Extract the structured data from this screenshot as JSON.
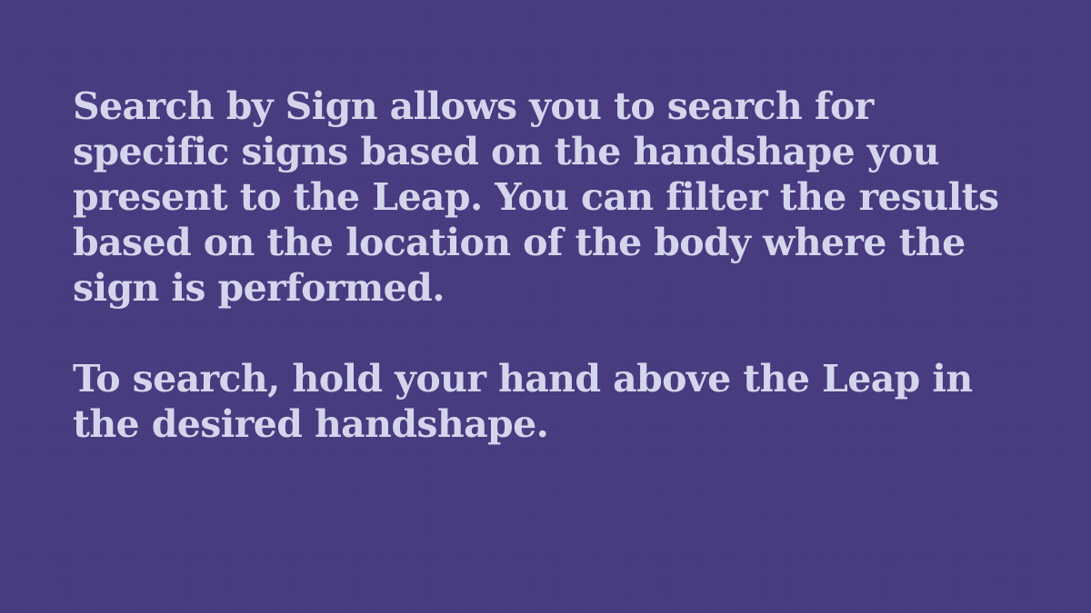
{
  "instructions": {
    "intro": "Search by Sign allows you to search for specific signs based on the handshape you present to the Leap. You can filter the results based on the location of the body where the sign is performed.",
    "how_to": "To search, hold your hand above the Leap in the desired handshape."
  },
  "colors": {
    "background": "#473a7f",
    "text": "#d4d5ec"
  }
}
